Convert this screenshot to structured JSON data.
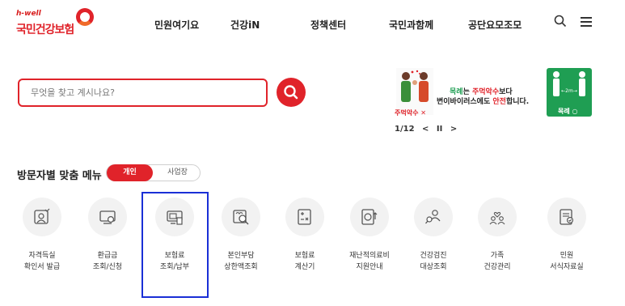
{
  "header": {
    "logo_small_brand": "h-well",
    "logo_main": "국민건강보험",
    "nav": [
      "민원여기요",
      "건강iN",
      "정책센터",
      "국민과함께",
      "공단요모조모"
    ]
  },
  "search": {
    "placeholder": "무엇을 찾고 계시나요?"
  },
  "banner": {
    "left_caption": "주먹악수 ✕",
    "right_caption": "목례 ○",
    "right_distance": "←2m→",
    "line1_a": "목례",
    "line1_b": "는 ",
    "line1_c": "주먹악수",
    "line1_d": "보다",
    "line2_a": "변이바이러스에도 ",
    "line2_b": "안전",
    "line2_c": "합니다.",
    "pager": {
      "current": "1",
      "total": "12",
      "label": "1/12",
      "prev": "<",
      "pause": "II",
      "next": ">"
    }
  },
  "visitor_menu": {
    "title": "방문자별 맞춤 메뉴",
    "toggle_active": "개인",
    "toggle_inactive": "사업장"
  },
  "menu_items": [
    {
      "line1": "자격득실",
      "line2": "확인서 발급",
      "icon": "certificate-icon"
    },
    {
      "line1": "환급금",
      "line2": "조회/신청",
      "icon": "refund-icon"
    },
    {
      "line1": "보험료",
      "line2": "조회/납부",
      "icon": "premium-payment-icon"
    },
    {
      "line1": "본인부담",
      "line2": "상한액조회",
      "icon": "copay-search-icon"
    },
    {
      "line1": "보험료",
      "line2": "계산기",
      "icon": "calculator-icon"
    },
    {
      "line1": "재난적의료비",
      "line2": "지원안내",
      "icon": "medical-aid-icon"
    },
    {
      "line1": "건강검진",
      "line2": "대상조회",
      "icon": "checkup-search-icon"
    },
    {
      "line1": "가족",
      "line2": "건강관리",
      "icon": "family-health-icon"
    },
    {
      "line1": "민원",
      "line2": "서식자료실",
      "icon": "forms-icon"
    }
  ],
  "colors": {
    "brand_red": "#e0232a",
    "highlight_blue": "#1a2fd6",
    "banner_green": "#1f9e53"
  }
}
